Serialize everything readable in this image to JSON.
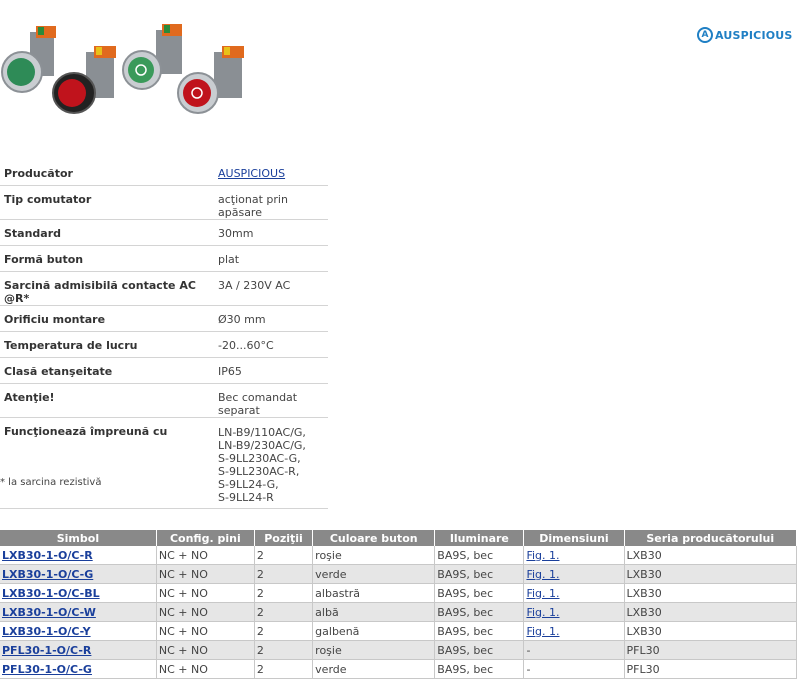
{
  "brand": {
    "mark": "A",
    "name": "AUSPICIOUS",
    "color": "#1f7fc4"
  },
  "product_image": {
    "icons": [
      "green-pushbutton-icon",
      "red-pushbutton-icon",
      "green-pushbutton-icon",
      "red-pushbutton-icon"
    ]
  },
  "specs": [
    {
      "key": "Producător",
      "value": "AUSPICIOUS",
      "link": true
    },
    {
      "key": "Tip comutator",
      "value": "acţionat prin apăsare"
    },
    {
      "key": "Standard",
      "value": "30mm"
    },
    {
      "key": "Formă buton",
      "value": "plat"
    },
    {
      "key": "Sarcină admisibilă contacte AC @R*",
      "value": "3A / 230V AC"
    },
    {
      "key": "Orificiu montare",
      "value": "Ø30 mm"
    },
    {
      "key": "Temperatura de lucru",
      "value": "-20...60°C"
    },
    {
      "key": "Clasă etanşeitate",
      "value": "IP65"
    },
    {
      "key": "Atenţie!",
      "value": "Bec comandat separat"
    },
    {
      "key": "Funcţionează împreună cu",
      "value": "LN-B9/110AC/G,\nLN-B9/230AC/G,\nS-9LL230AC-G,\nS-9LL230AC-R,\nS-9LL24-G,\nS-9LL24-R"
    }
  ],
  "footnote": "* la sarcina rezistivă",
  "products": {
    "headers": [
      "Simbol",
      "Config. pini",
      "Poziţii",
      "Culoare buton",
      "Iluminare",
      "Dimensiuni",
      "Seria producătorului"
    ],
    "rows": [
      [
        "LXB30-1-O/C-R",
        "NC + NO",
        "2",
        "roşie",
        "BA9S, bec",
        "Fig. 1.",
        "LXB30"
      ],
      [
        "LXB30-1-O/C-G",
        "NC + NO",
        "2",
        "verde",
        "BA9S, bec",
        "Fig. 1.",
        "LXB30"
      ],
      [
        "LXB30-1-O/C-BL",
        "NC + NO",
        "2",
        "albastră",
        "BA9S, bec",
        "Fig. 1.",
        "LXB30"
      ],
      [
        "LXB30-1-O/C-W",
        "NC + NO",
        "2",
        "albă",
        "BA9S, bec",
        "Fig. 1.",
        "LXB30"
      ],
      [
        "LXB30-1-O/C-Y",
        "NC + NO",
        "2",
        "galbenă",
        "BA9S, bec",
        "Fig. 1.",
        "LXB30"
      ],
      [
        "PFL30-1-O/C-R",
        "NC + NO",
        "2",
        "roşie",
        "BA9S, bec",
        "-",
        "PFL30"
      ],
      [
        "PFL30-1-O/C-G",
        "NC + NO",
        "2",
        "verde",
        "BA9S, bec",
        "-",
        "PFL30"
      ]
    ]
  }
}
